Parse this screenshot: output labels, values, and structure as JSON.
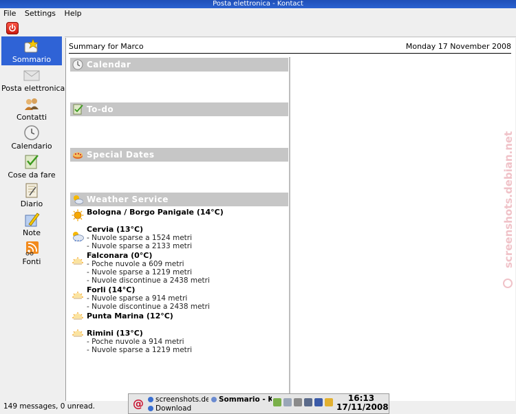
{
  "window": {
    "title": "Posta elettronica - Kontact"
  },
  "menu": {
    "items": [
      "File",
      "Settings",
      "Help"
    ]
  },
  "sidebar": {
    "items": [
      {
        "label": "Sommario",
        "icon": "summary-star-icon",
        "active": true
      },
      {
        "label": "Posta elettronica",
        "icon": "envelope-icon",
        "active": false
      },
      {
        "label": "Contatti",
        "icon": "contacts-people-icon",
        "active": false
      },
      {
        "label": "Calendario",
        "icon": "clock-calendar-icon",
        "active": false
      },
      {
        "label": "Cose da fare",
        "icon": "todo-check-icon",
        "active": false
      },
      {
        "label": "Diario",
        "icon": "journal-notebook-icon",
        "active": false
      },
      {
        "label": "Note",
        "icon": "notes-pencil-icon",
        "active": false
      },
      {
        "label": "Fonti",
        "icon": "feeds-rss-icon",
        "active": false
      }
    ]
  },
  "summary": {
    "title": "Summary for Marco",
    "date": "Monday 17 November 2008",
    "sections": {
      "calendar": "Calendar",
      "todo": "To-do",
      "special": "Special Dates",
      "weather": "Weather Service"
    },
    "weather": [
      {
        "city": "Bologna / Borgo Panigale (14°C)",
        "icon": "sunny-icon",
        "lines": []
      },
      {
        "city": "Cervia (13°C)",
        "icon": "cloudy-icon",
        "lines": [
          "- Nuvole sparse a 1524 metri",
          "- Nuvole sparse a 2133 metri"
        ]
      },
      {
        "city": "Falconara (0°C)",
        "icon": "night-partly-cloudy-icon",
        "lines": [
          "- Poche nuvole a 609 metri",
          "- Nuvole sparse a 1219 metri",
          "- Nuvole discontinue a 2438 metri"
        ]
      },
      {
        "city": "Forli (14°C)",
        "icon": "night-partly-cloudy-icon",
        "lines": [
          "- Nuvole sparse a 914 metri",
          "- Nuvole discontinue a 2438 metri"
        ]
      },
      {
        "city": "Punta Marina (12°C)",
        "icon": "night-partly-cloudy-icon",
        "lines": []
      },
      {
        "city": "Rimini (13°C)",
        "icon": "night-partly-cloudy-icon",
        "lines": [
          "- Poche nuvole a 914 metri",
          "- Nuvole sparse a 1219 metri"
        ]
      }
    ]
  },
  "status": {
    "message": "149 messages, 0 unread."
  },
  "watermark": "screenshots.debian.net",
  "taskbar": {
    "tasks": [
      "screenshots.deb",
      "Sommario - Ko",
      "Download"
    ],
    "clock_time": "16:13",
    "clock_date": "17/11/2008"
  },
  "colors": {
    "accent": "#2f63d6",
    "section_bg": "#c6c6c6",
    "titlebar": "#2a5ec9"
  }
}
